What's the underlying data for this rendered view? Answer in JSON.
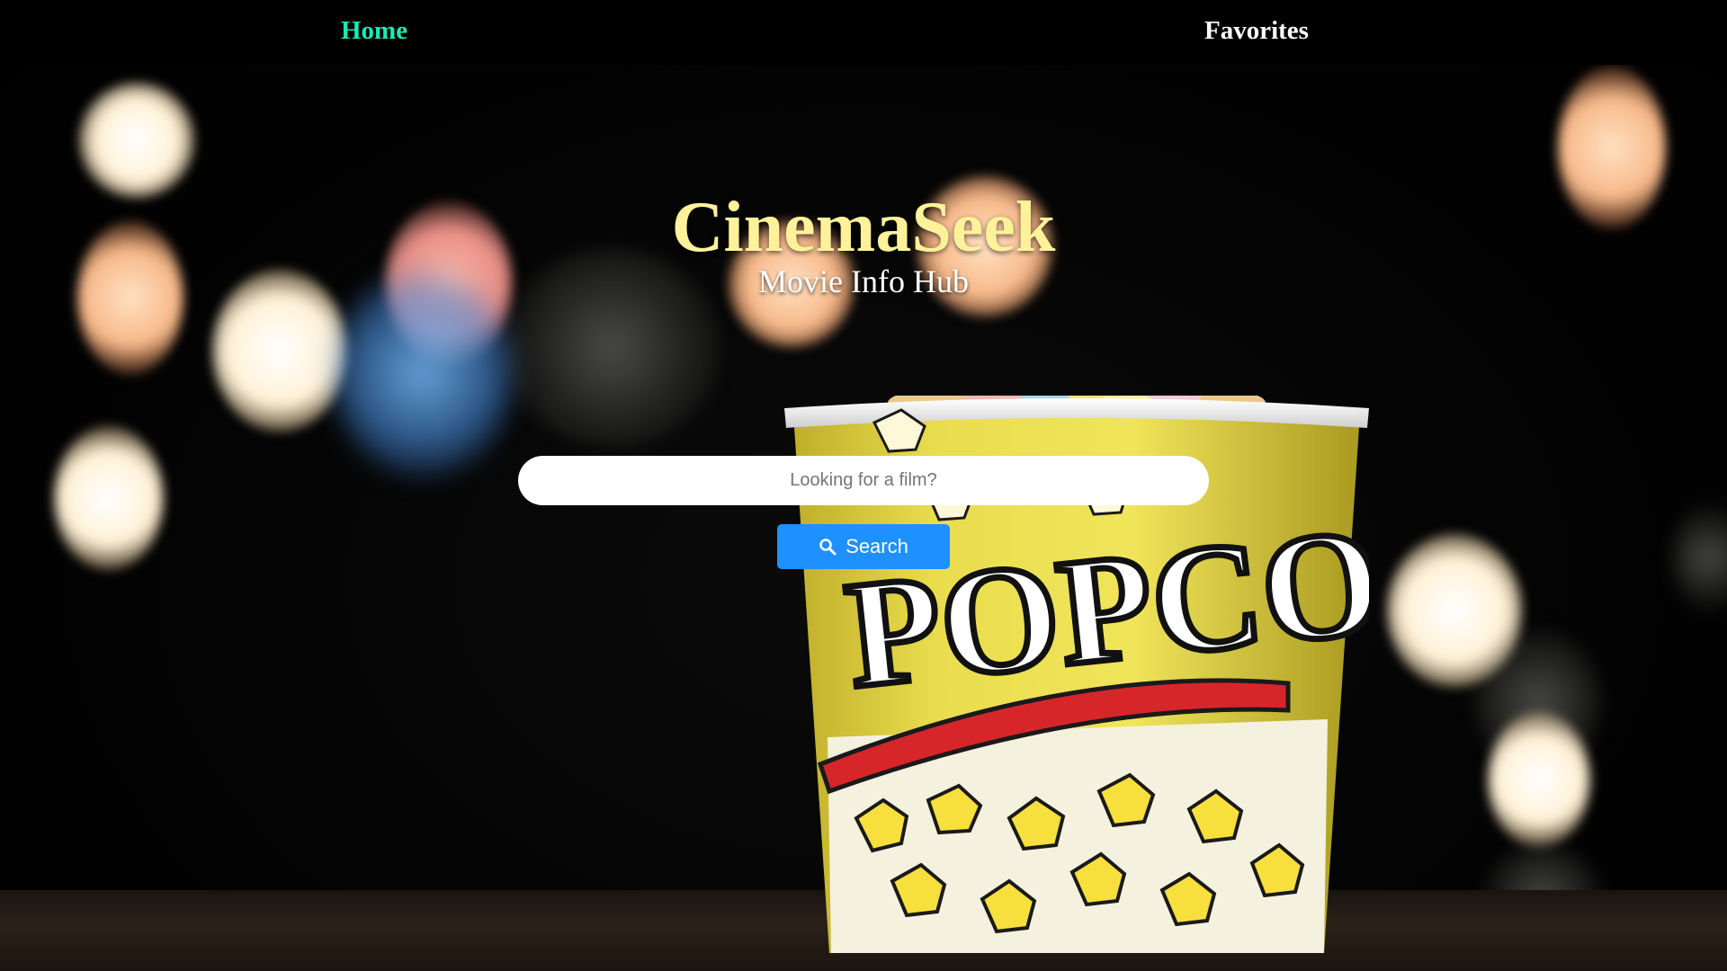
{
  "nav": {
    "home_label": "Home",
    "favorites_label": "Favorites"
  },
  "hero": {
    "title": "CinemaSeek",
    "subtitle": "Movie Info Hub"
  },
  "search": {
    "placeholder": "Looking for a film?",
    "value": "",
    "button_label": "Search",
    "button_icon": "search-icon"
  },
  "background": {
    "image_text": "POPCORN"
  },
  "colors": {
    "nav_active": "#1de9b6",
    "title": "#fdf29a",
    "button": "#1e90ff"
  }
}
